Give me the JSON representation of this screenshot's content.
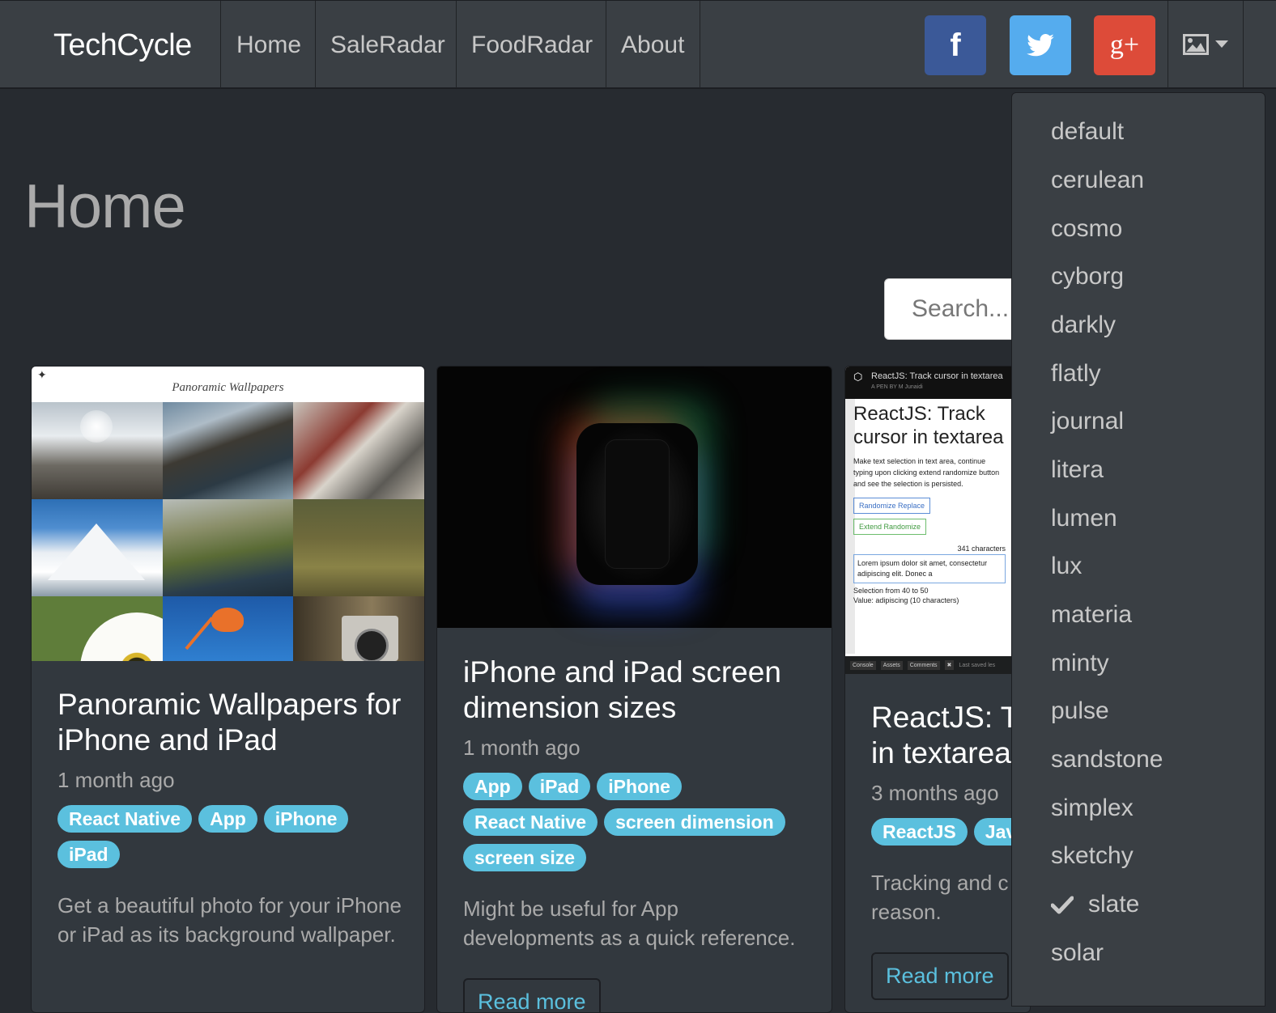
{
  "navbar": {
    "brand": "TechCycle",
    "links": [
      "Home",
      "SaleRadar",
      "FoodRadar",
      "About"
    ],
    "social": {
      "facebook_label": "f",
      "googleplus_label": "g+"
    }
  },
  "page": {
    "title": "Home",
    "search_placeholder": "Search..."
  },
  "cards": [
    {
      "thumb_title": "Panoramic Wallpapers",
      "title": "Panoramic Wallpapers for iPhone and iPad",
      "date": "1 month ago",
      "tags": [
        "React Native",
        "App",
        "iPhone",
        "iPad"
      ],
      "text": "Get a beautiful photo for your iPhone or iPad as its background wallpaper."
    },
    {
      "title": "iPhone and iPad screen dimension sizes",
      "date": "1 month ago",
      "tags": [
        "App",
        "iPad",
        "iPhone",
        "React Native",
        "screen dimension",
        "screen size"
      ],
      "text": "Might be useful for App developments as a quick reference.",
      "readmore": "Read more"
    },
    {
      "thumb": {
        "header": "ReactJS: Track cursor in textarea",
        "pen_by": "A PEN BY M Junaidi",
        "heading": "ReactJS: Track cursor in textarea",
        "desc": "Make text selection in text area, continue typing upon clicking extend randomize button and see the selection is persisted.",
        "btn1": "Randomize Replace",
        "btn2": "Extend Randomize",
        "chars": "341 characters",
        "textarea": "Lorem ipsum dolor sit amet, consectetur adipiscing elit. Donec a",
        "selection": "Selection from 40 to 50",
        "value": "Value: adipiscing (10 characters)",
        "footer": [
          "Console",
          "Assets",
          "Comments",
          "✖",
          "Last saved les"
        ]
      },
      "title": "ReactJS: Track cursor in textarea",
      "title_line1": "ReactJS: T",
      "title_line2": "in textarea",
      "date": "3 months ago",
      "tags": [
        "ReactJS",
        "Jav"
      ],
      "text_line1": "Tracking and c",
      "text_line2": "reason.",
      "readmore": "Read more"
    }
  ],
  "themes": {
    "items": [
      "default",
      "cerulean",
      "cosmo",
      "cyborg",
      "darkly",
      "flatly",
      "journal",
      "litera",
      "lumen",
      "lux",
      "materia",
      "minty",
      "pulse",
      "sandstone",
      "simplex",
      "sketchy",
      "slate",
      "solar"
    ],
    "selected": "slate"
  },
  "colors": {
    "body_bg": "#272b30",
    "navbar_bg": "#3a3f44",
    "card_bg": "#32383e",
    "tag_bg": "#5bc0de",
    "facebook": "#3b5998",
    "twitter": "#55acee",
    "googleplus": "#dd4b39"
  },
  "icons": {
    "facebook": "facebook-icon",
    "twitter": "twitter-icon",
    "googleplus": "google-plus-icon",
    "theme": "image-icon",
    "caret": "caret-down-icon",
    "check": "check-icon"
  }
}
